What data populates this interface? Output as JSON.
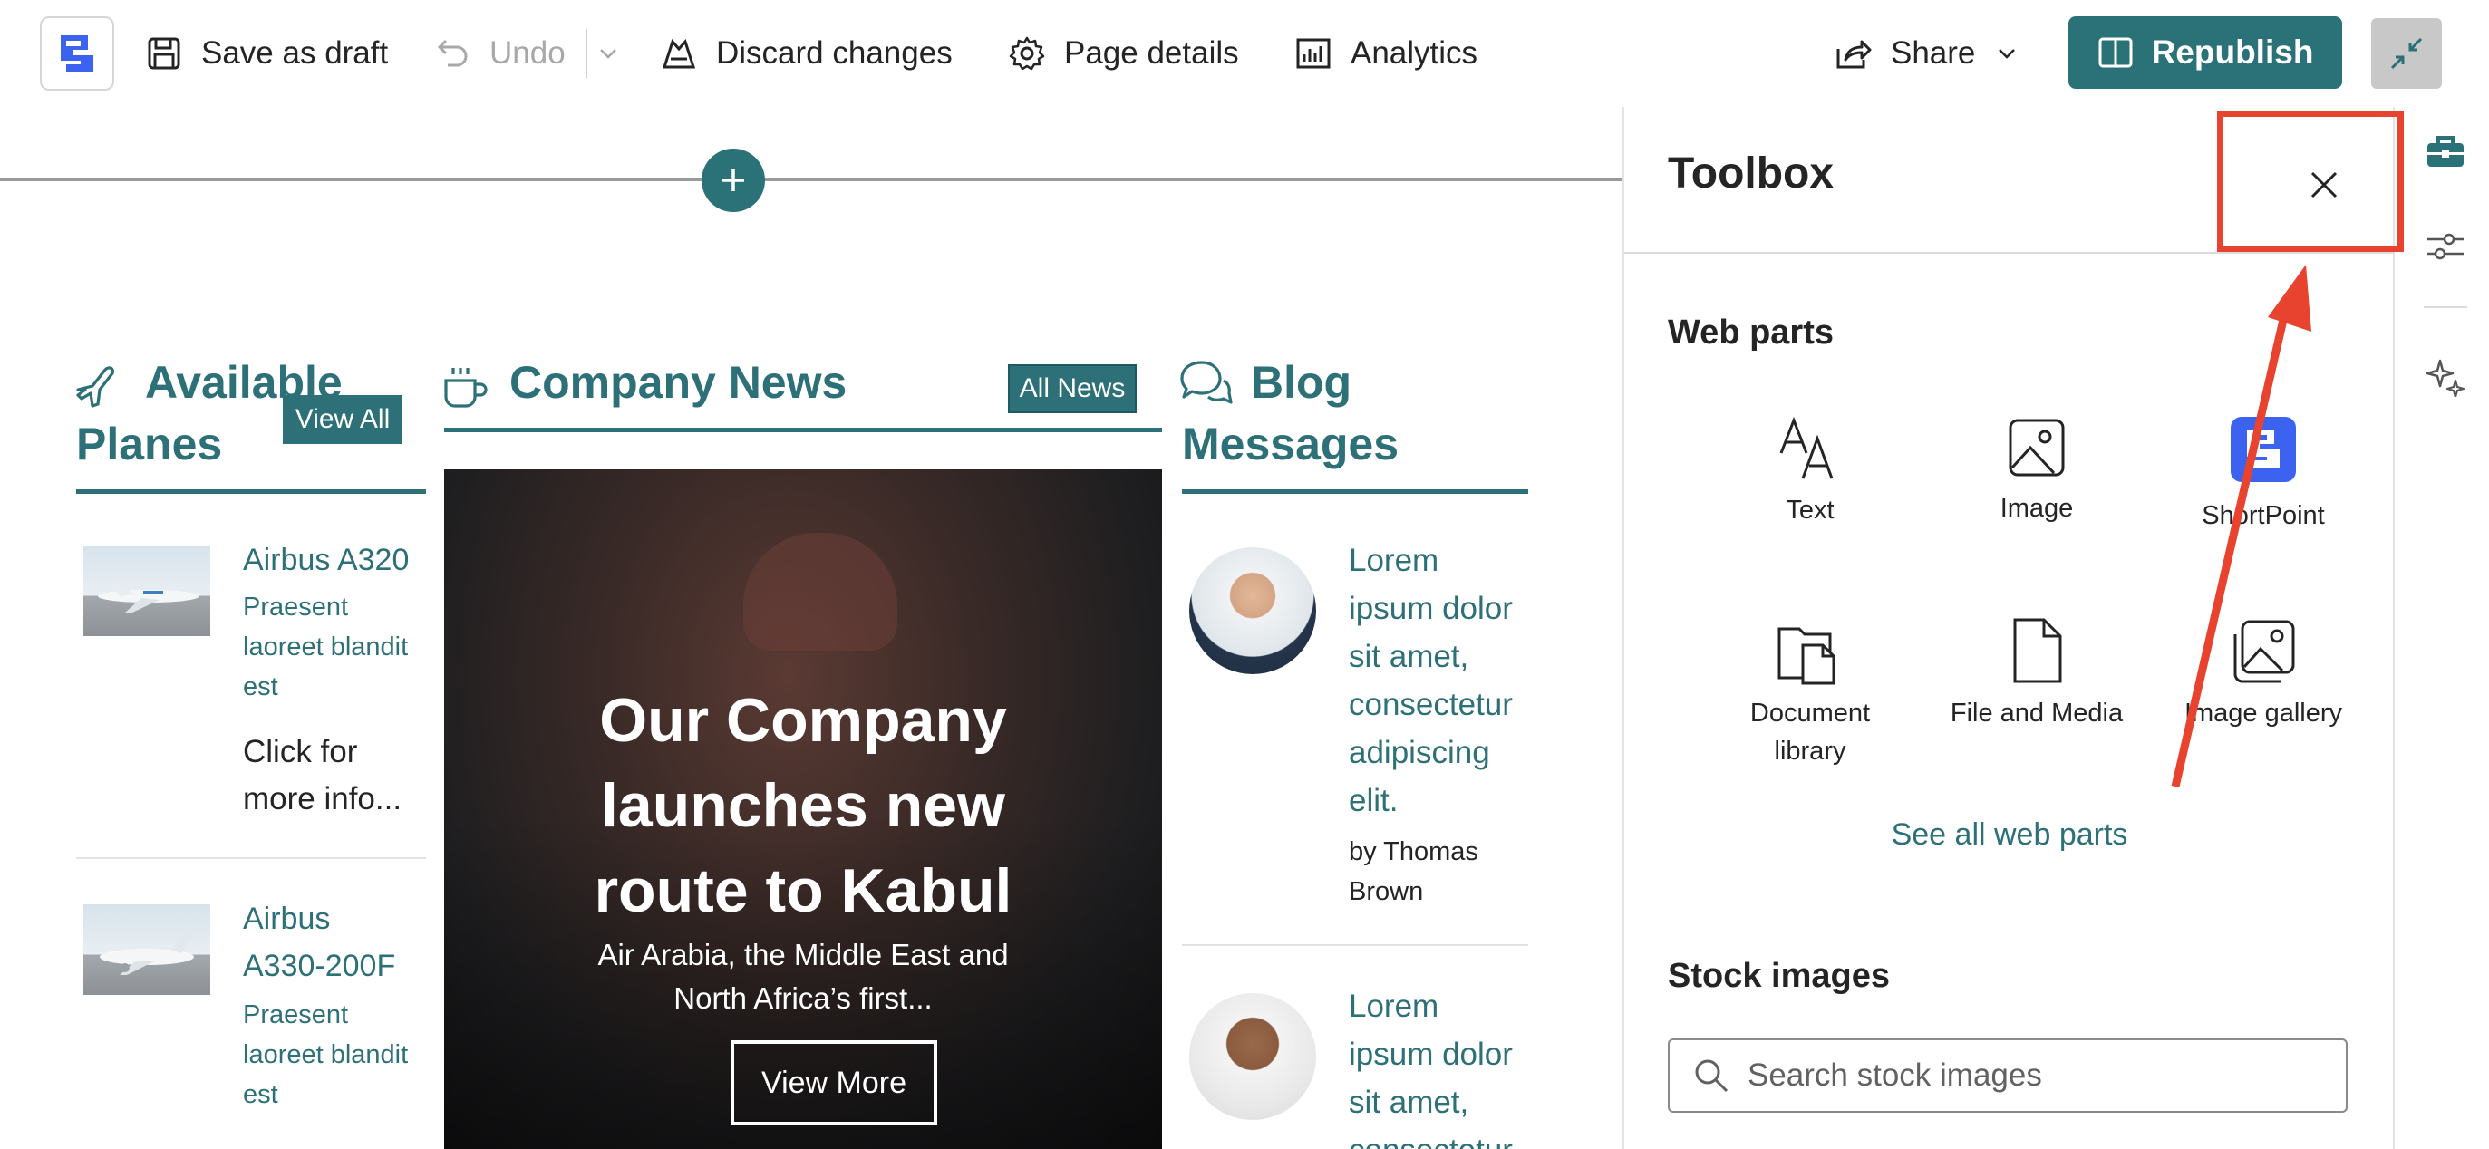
{
  "toolbar": {
    "save_draft": "Save as draft",
    "undo": "Undo",
    "discard": "Discard changes",
    "page_details": "Page details",
    "analytics": "Analytics",
    "share": "Share",
    "republish": "Republish"
  },
  "planes": {
    "title_line1": "Available",
    "title_line2": "Planes",
    "view_all": "View All",
    "items": [
      {
        "name": "Airbus A320",
        "desc_lines": [
          "Praesent",
          "laoreet blandit",
          "est"
        ],
        "more_lines": [
          "Click for",
          "more info..."
        ]
      },
      {
        "name_lines": [
          "Airbus",
          "A330-200F"
        ],
        "desc_lines": [
          "Praesent",
          "laoreet blandit",
          "est"
        ]
      }
    ]
  },
  "news": {
    "title": "Company News",
    "all_news": "All News",
    "headline_lines": [
      "Our Company",
      "launches new",
      "route to Kabul"
    ],
    "summary_lines": [
      "Air Arabia, the Middle East and",
      "North Africa’s first..."
    ],
    "view_more": "View More"
  },
  "blog": {
    "title_line1": "Blog",
    "title_line2": "Messages",
    "posts": [
      {
        "text_lines": [
          "Lorem",
          "ipsum dolor",
          "sit amet,",
          "consectetur",
          "adipiscing",
          "elit."
        ],
        "author_lines": [
          "by Thomas",
          "Brown"
        ]
      },
      {
        "text_lines": [
          "Lorem",
          "ipsum dolor",
          "sit amet,",
          "consectetur"
        ]
      }
    ]
  },
  "toolbox": {
    "title": "Toolbox",
    "web_parts_heading": "Web parts",
    "web_parts": [
      {
        "label": "Text",
        "icon": "text-icon"
      },
      {
        "label": "Image",
        "icon": "image-icon"
      },
      {
        "label": "ShortPoint",
        "icon": "shortpoint-icon"
      },
      {
        "label_lines": [
          "Document",
          "library"
        ],
        "icon": "document-library-icon"
      },
      {
        "label": "File and Media",
        "icon": "file-icon"
      },
      {
        "label": "Image gallery",
        "icon": "image-gallery-icon"
      }
    ],
    "see_all": "See all web parts",
    "stock_heading": "Stock images",
    "search_placeholder": "Search stock images"
  },
  "colors": {
    "accent": "#2e7078",
    "primary_button": "#2b7178",
    "annotation": "#e8432e",
    "shortpoint_blue": "#3b63f0"
  }
}
